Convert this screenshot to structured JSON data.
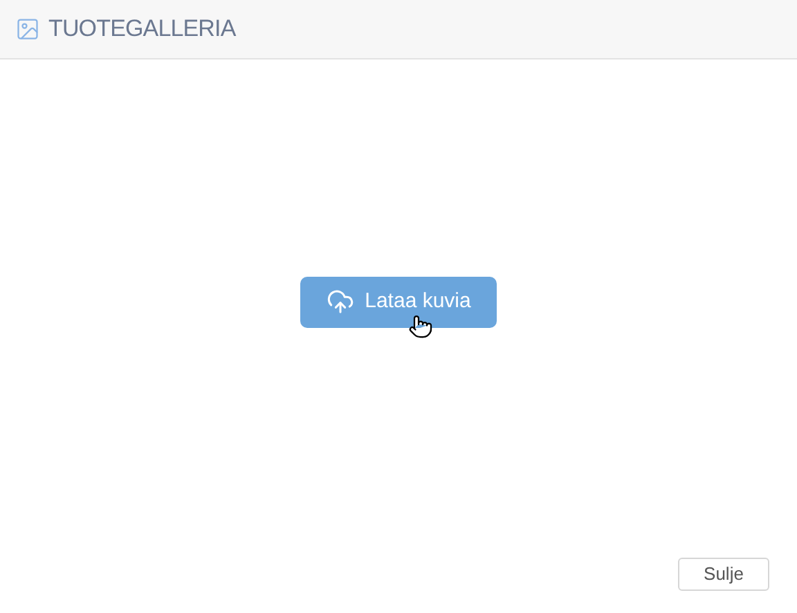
{
  "header": {
    "title": "TUOTEGALLERIA"
  },
  "upload_button": {
    "label": "Lataa kuvia"
  },
  "close_button": {
    "label": "Sulje"
  }
}
